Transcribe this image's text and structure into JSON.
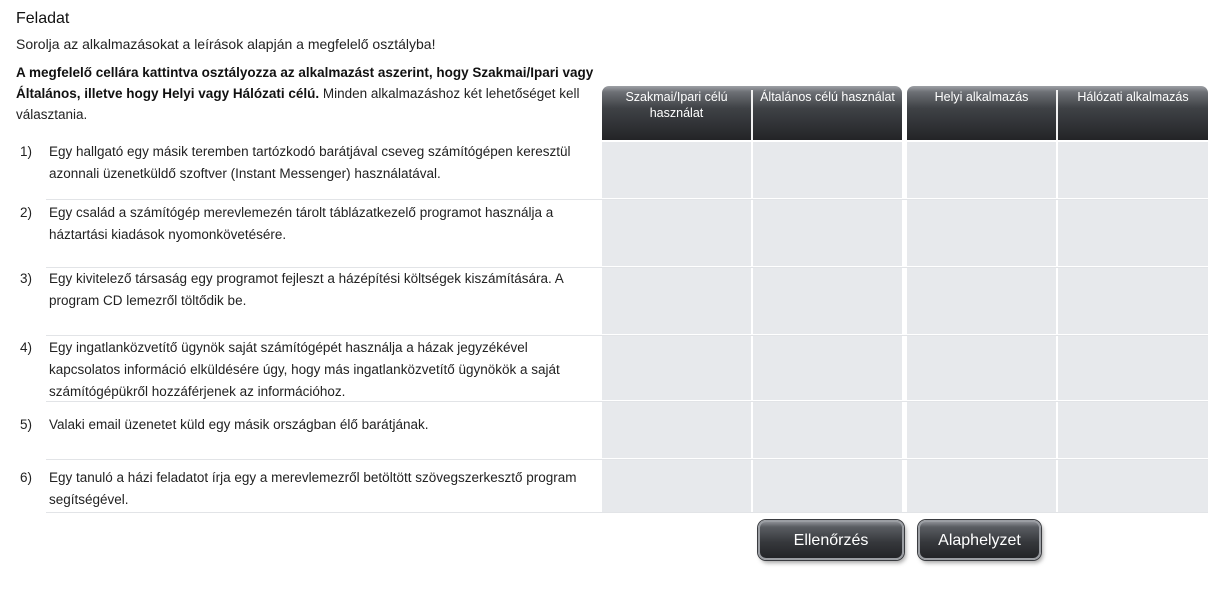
{
  "title": "Feladat",
  "subtitle": "Sorolja az alkalmazásokat  a leírások alapján a megfelelő osztályba!",
  "instructions": {
    "bold": "A megfelelő cellára kattintva osztályozza az alkalmazást aszerint, hogy Szakmai/Ipari vagy Általános, illetve hogy Helyi vagy Hálózati célú.",
    "normal": " Minden alkalmazáshoz két lehetőséget kell választania."
  },
  "columns": {
    "group1": [
      "Szakmai/Ipari célú használat",
      "Általános célú használat"
    ],
    "group2": [
      "Helyi alkalmazás",
      "Hálózati alkalmazás"
    ]
  },
  "tasks": [
    {
      "num": "1)",
      "text": "Egy hallgató egy másik teremben tartózkodó barátjával cseveg számítógépen keresztül azonnali üzenetküldő szoftver (Instant Messenger) használatával."
    },
    {
      "num": "2)",
      "text": "Egy család a számítógép merevlemezén tárolt táblázatkezelő programot használja a háztartási kiadások nyomonkövetésére."
    },
    {
      "num": "3)",
      "text": "Egy kivitelező társaság egy programot fejleszt a házépítési költségek kiszámítására. A program CD lemezről töltődik be."
    },
    {
      "num": "4)",
      "text": "Egy ingatlanközvetítő ügynök saját számítógépét használja a házak jegyzékével kapcsolatos információ elküldésére úgy, hogy más ingatlanközvetítő ügynökök a saját számítógépükről hozzáférjenek az információhoz."
    },
    {
      "num": "5)",
      "text": "Valaki email üzenetet küld egy másik országban élő barátjának."
    },
    {
      "num": "6)",
      "text": "Egy tanuló a házi feladatot írja egy a merevlemezről betöltött szövegszerkesztő program segítségével."
    }
  ],
  "buttons": {
    "check": "Ellenőrzés",
    "reset": "Alaphelyzet"
  }
}
